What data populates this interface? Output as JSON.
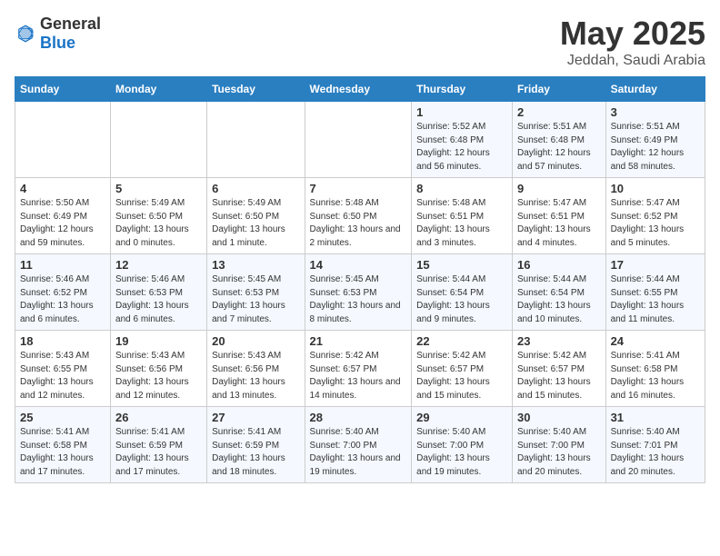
{
  "logo": {
    "general": "General",
    "blue": "Blue"
  },
  "title": "May 2025",
  "subtitle": "Jeddah, Saudi Arabia",
  "days_of_week": [
    "Sunday",
    "Monday",
    "Tuesday",
    "Wednesday",
    "Thursday",
    "Friday",
    "Saturday"
  ],
  "weeks": [
    [
      {
        "day": "",
        "detail": ""
      },
      {
        "day": "",
        "detail": ""
      },
      {
        "day": "",
        "detail": ""
      },
      {
        "day": "",
        "detail": ""
      },
      {
        "day": "1",
        "detail": "Sunrise: 5:52 AM\nSunset: 6:48 PM\nDaylight: 12 hours and 56 minutes."
      },
      {
        "day": "2",
        "detail": "Sunrise: 5:51 AM\nSunset: 6:48 PM\nDaylight: 12 hours and 57 minutes."
      },
      {
        "day": "3",
        "detail": "Sunrise: 5:51 AM\nSunset: 6:49 PM\nDaylight: 12 hours and 58 minutes."
      }
    ],
    [
      {
        "day": "4",
        "detail": "Sunrise: 5:50 AM\nSunset: 6:49 PM\nDaylight: 12 hours and 59 minutes."
      },
      {
        "day": "5",
        "detail": "Sunrise: 5:49 AM\nSunset: 6:50 PM\nDaylight: 13 hours and 0 minutes."
      },
      {
        "day": "6",
        "detail": "Sunrise: 5:49 AM\nSunset: 6:50 PM\nDaylight: 13 hours and 1 minute."
      },
      {
        "day": "7",
        "detail": "Sunrise: 5:48 AM\nSunset: 6:50 PM\nDaylight: 13 hours and 2 minutes."
      },
      {
        "day": "8",
        "detail": "Sunrise: 5:48 AM\nSunset: 6:51 PM\nDaylight: 13 hours and 3 minutes."
      },
      {
        "day": "9",
        "detail": "Sunrise: 5:47 AM\nSunset: 6:51 PM\nDaylight: 13 hours and 4 minutes."
      },
      {
        "day": "10",
        "detail": "Sunrise: 5:47 AM\nSunset: 6:52 PM\nDaylight: 13 hours and 5 minutes."
      }
    ],
    [
      {
        "day": "11",
        "detail": "Sunrise: 5:46 AM\nSunset: 6:52 PM\nDaylight: 13 hours and 6 minutes."
      },
      {
        "day": "12",
        "detail": "Sunrise: 5:46 AM\nSunset: 6:53 PM\nDaylight: 13 hours and 6 minutes."
      },
      {
        "day": "13",
        "detail": "Sunrise: 5:45 AM\nSunset: 6:53 PM\nDaylight: 13 hours and 7 minutes."
      },
      {
        "day": "14",
        "detail": "Sunrise: 5:45 AM\nSunset: 6:53 PM\nDaylight: 13 hours and 8 minutes."
      },
      {
        "day": "15",
        "detail": "Sunrise: 5:44 AM\nSunset: 6:54 PM\nDaylight: 13 hours and 9 minutes."
      },
      {
        "day": "16",
        "detail": "Sunrise: 5:44 AM\nSunset: 6:54 PM\nDaylight: 13 hours and 10 minutes."
      },
      {
        "day": "17",
        "detail": "Sunrise: 5:44 AM\nSunset: 6:55 PM\nDaylight: 13 hours and 11 minutes."
      }
    ],
    [
      {
        "day": "18",
        "detail": "Sunrise: 5:43 AM\nSunset: 6:55 PM\nDaylight: 13 hours and 12 minutes."
      },
      {
        "day": "19",
        "detail": "Sunrise: 5:43 AM\nSunset: 6:56 PM\nDaylight: 13 hours and 12 minutes."
      },
      {
        "day": "20",
        "detail": "Sunrise: 5:43 AM\nSunset: 6:56 PM\nDaylight: 13 hours and 13 minutes."
      },
      {
        "day": "21",
        "detail": "Sunrise: 5:42 AM\nSunset: 6:57 PM\nDaylight: 13 hours and 14 minutes."
      },
      {
        "day": "22",
        "detail": "Sunrise: 5:42 AM\nSunset: 6:57 PM\nDaylight: 13 hours and 15 minutes."
      },
      {
        "day": "23",
        "detail": "Sunrise: 5:42 AM\nSunset: 6:57 PM\nDaylight: 13 hours and 15 minutes."
      },
      {
        "day": "24",
        "detail": "Sunrise: 5:41 AM\nSunset: 6:58 PM\nDaylight: 13 hours and 16 minutes."
      }
    ],
    [
      {
        "day": "25",
        "detail": "Sunrise: 5:41 AM\nSunset: 6:58 PM\nDaylight: 13 hours and 17 minutes."
      },
      {
        "day": "26",
        "detail": "Sunrise: 5:41 AM\nSunset: 6:59 PM\nDaylight: 13 hours and 17 minutes."
      },
      {
        "day": "27",
        "detail": "Sunrise: 5:41 AM\nSunset: 6:59 PM\nDaylight: 13 hours and 18 minutes."
      },
      {
        "day": "28",
        "detail": "Sunrise: 5:40 AM\nSunset: 7:00 PM\nDaylight: 13 hours and 19 minutes."
      },
      {
        "day": "29",
        "detail": "Sunrise: 5:40 AM\nSunset: 7:00 PM\nDaylight: 13 hours and 19 minutes."
      },
      {
        "day": "30",
        "detail": "Sunrise: 5:40 AM\nSunset: 7:00 PM\nDaylight: 13 hours and 20 minutes."
      },
      {
        "day": "31",
        "detail": "Sunrise: 5:40 AM\nSunset: 7:01 PM\nDaylight: 13 hours and 20 minutes."
      }
    ]
  ]
}
